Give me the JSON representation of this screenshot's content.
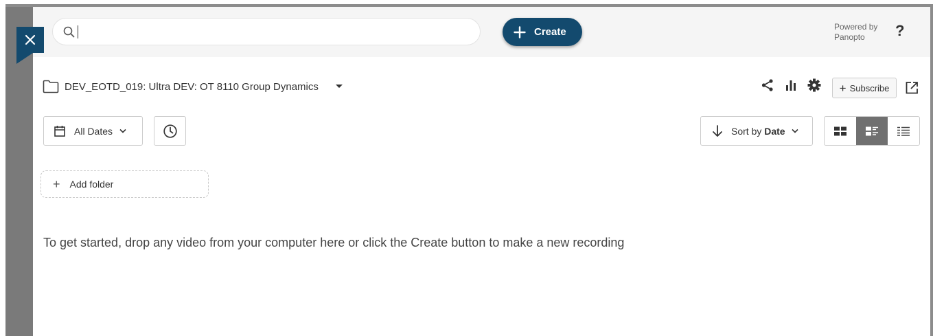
{
  "search": {
    "placeholder": "",
    "value": ""
  },
  "create_button": {
    "label": "Create"
  },
  "powered_by": {
    "line1": "Powered by",
    "line2": "Panopto"
  },
  "help": {
    "label": "?"
  },
  "folder": {
    "title": "DEV_EOTD_019: Ultra DEV: OT 8110 Group Dynamics"
  },
  "subscribe": {
    "label": "Subscribe"
  },
  "filters": {
    "dates_label": "All Dates"
  },
  "sort": {
    "prefix": "Sort by",
    "field": "Date"
  },
  "add_folder": {
    "label": "Add folder"
  },
  "empty_state": {
    "message": "To get started, drop any video from your computer here or click the Create button to make a new recording"
  },
  "colors": {
    "brand": "#134a6e",
    "active_view": "#707070",
    "topbar": "#f5f5f5"
  },
  "icons": [
    "close-icon",
    "search-icon",
    "plus-icon",
    "folder-icon",
    "caret-down-icon",
    "share-icon",
    "stats-icon",
    "gear-icon",
    "external-link-icon",
    "calendar-icon",
    "chevron-down-icon",
    "clock-icon",
    "arrow-down-icon",
    "grid-view-icon",
    "detail-view-icon",
    "list-view-icon"
  ],
  "view_mode": {
    "selected": "detail"
  }
}
